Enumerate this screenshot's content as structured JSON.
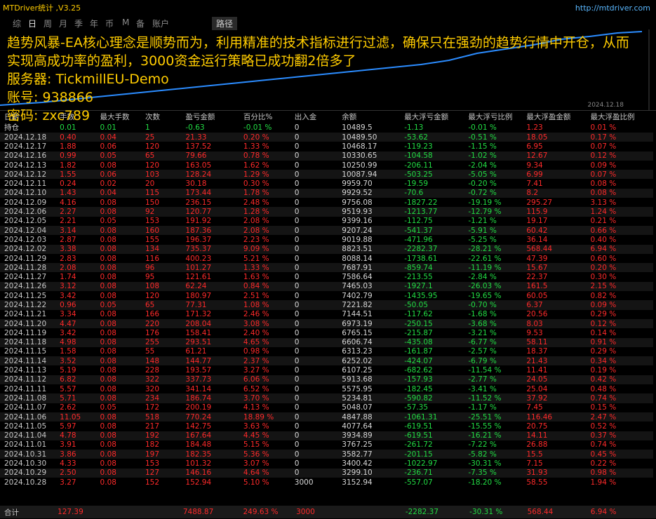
{
  "titlebar": {
    "app_title": "MTDriver统计 ,V3.25",
    "url": "http://mtdriver.com"
  },
  "tabs": [
    "综",
    "日",
    "周",
    "月",
    "季",
    "年",
    "币",
    "M",
    "备",
    "账户"
  ],
  "active_tab": "日",
  "path_tab": "路径",
  "overlay": {
    "line1": "趋势风暴-EA核心理念是顺势而为，利用精准的技术指标进行过滤，确保只在强劲的趋势行情中开仓，从而实现高成功率的盈利，3000资金运行策略已成功翻2倍多了",
    "server": "服务器: TickmillEU-Demo",
    "account": "账号: 938866",
    "password": "密码: zxc789"
  },
  "chart_date_label": "2024.12.18",
  "columns": [
    "日期",
    "手数",
    "最大手数",
    "次数",
    "盈亏金额",
    "百分比%",
    "出入金",
    "余额",
    "最大浮亏金额",
    "最大浮亏比例",
    "最大浮盈金额",
    "最大浮盈比例"
  ],
  "rows": [
    [
      "持仓",
      "0.01",
      "0.01",
      "1",
      "-0.63",
      "-0.01 %",
      "0",
      "10489.5",
      "-1.13",
      "-0.01 %",
      "1.23",
      "0.01 %"
    ],
    [
      "2024.12.18",
      "0.40",
      "0.04",
      "25",
      "21.33",
      "0.20 %",
      "0",
      "10489.50",
      "-53.62",
      "-0.51 %",
      "18.05",
      "0.17 %"
    ],
    [
      "2024.12.17",
      "1.88",
      "0.06",
      "120",
      "137.52",
      "1.33 %",
      "0",
      "10468.17",
      "-119.23",
      "-1.15 %",
      "6.95",
      "0.07 %"
    ],
    [
      "2024.12.16",
      "0.99",
      "0.05",
      "65",
      "79.66",
      "0.78 %",
      "0",
      "10330.65",
      "-104.58",
      "-1.02 %",
      "12.67",
      "0.12 %"
    ],
    [
      "2024.12.13",
      "1.82",
      "0.08",
      "120",
      "163.05",
      "1.62 %",
      "0",
      "10250.99",
      "-206.11",
      "-2.04 %",
      "9.34",
      "0.09 %"
    ],
    [
      "2024.12.12",
      "1.55",
      "0.06",
      "103",
      "128.24",
      "1.29 %",
      "0",
      "10087.94",
      "-503.25",
      "-5.05 %",
      "6.99",
      "0.07 %"
    ],
    [
      "2024.12.11",
      "0.24",
      "0.02",
      "20",
      "30.18",
      "0.30 %",
      "0",
      "9959.70",
      "-19.59",
      "-0.20 %",
      "7.41",
      "0.08 %"
    ],
    [
      "2024.12.10",
      "1.43",
      "0.04",
      "115",
      "173.44",
      "1.78 %",
      "0",
      "9929.52",
      "-70.6",
      "-0.72 %",
      "8.2",
      "0.08 %"
    ],
    [
      "2024.12.09",
      "4.16",
      "0.08",
      "150",
      "236.15",
      "2.48 %",
      "0",
      "9756.08",
      "-1827.22",
      "-19.19 %",
      "295.27",
      "3.13 %"
    ],
    [
      "2024.12.06",
      "2.27",
      "0.08",
      "92",
      "120.77",
      "1.28 %",
      "0",
      "9519.93",
      "-1213.77",
      "-12.79 %",
      "115.9",
      "1.24 %"
    ],
    [
      "2024.12.05",
      "2.21",
      "0.05",
      "153",
      "191.92",
      "2.08 %",
      "0",
      "9399.16",
      "-112.75",
      "-1.21 %",
      "19.17",
      "0.21 %"
    ],
    [
      "2024.12.04",
      "3.14",
      "0.08",
      "160",
      "187.36",
      "2.08 %",
      "0",
      "9207.24",
      "-541.37",
      "-5.91 %",
      "60.42",
      "0.66 %"
    ],
    [
      "2024.12.03",
      "2.87",
      "0.08",
      "155",
      "196.37",
      "2.23 %",
      "0",
      "9019.88",
      "-471.96",
      "-5.25 %",
      "36.14",
      "0.40 %"
    ],
    [
      "2024.12.02",
      "3.38",
      "0.08",
      "134",
      "735.37",
      "9.09 %",
      "0",
      "8823.51",
      "-2282.37",
      "-28.21 %",
      "568.44",
      "6.94 %"
    ],
    [
      "2024.11.29",
      "2.83",
      "0.08",
      "116",
      "400.23",
      "5.21 %",
      "0",
      "8088.14",
      "-1738.61",
      "-22.61 %",
      "47.39",
      "0.60 %"
    ],
    [
      "2024.11.28",
      "2.08",
      "0.08",
      "96",
      "101.27",
      "1.33 %",
      "0",
      "7687.91",
      "-859.74",
      "-11.19 %",
      "15.67",
      "0.20 %"
    ],
    [
      "2024.11.27",
      "1.74",
      "0.08",
      "95",
      "121.61",
      "1.63 %",
      "0",
      "7586.64",
      "-213.55",
      "-2.84 %",
      "22.37",
      "0.30 %"
    ],
    [
      "2024.11.26",
      "3.12",
      "0.08",
      "108",
      "62.24",
      "0.84 %",
      "0",
      "7465.03",
      "-1927.1",
      "-26.03 %",
      "161.5",
      "2.15 %"
    ],
    [
      "2024.11.25",
      "3.42",
      "0.08",
      "120",
      "180.97",
      "2.51 %",
      "0",
      "7402.79",
      "-1435.95",
      "-19.65 %",
      "60.05",
      "0.82 %"
    ],
    [
      "2024.11.22",
      "0.96",
      "0.05",
      "65",
      "77.31",
      "1.08 %",
      "0",
      "7221.82",
      "-50.05",
      "-0.70 %",
      "6.37",
      "0.09 %"
    ],
    [
      "2024.11.21",
      "3.34",
      "0.08",
      "166",
      "171.32",
      "2.46 %",
      "0",
      "7144.51",
      "-117.62",
      "-1.68 %",
      "20.56",
      "0.29 %"
    ],
    [
      "2024.11.20",
      "4.47",
      "0.08",
      "220",
      "208.04",
      "3.08 %",
      "0",
      "6973.19",
      "-250.15",
      "-3.68 %",
      "8.03",
      "0.12 %"
    ],
    [
      "2024.11.19",
      "3.42",
      "0.08",
      "176",
      "158.41",
      "2.40 %",
      "0",
      "6765.15",
      "-215.87",
      "-3.21 %",
      "9.53",
      "0.14 %"
    ],
    [
      "2024.11.18",
      "4.98",
      "0.08",
      "255",
      "293.51",
      "4.65 %",
      "0",
      "6606.74",
      "-435.08",
      "-6.77 %",
      "58.11",
      "0.91 %"
    ],
    [
      "2024.11.15",
      "1.58",
      "0.08",
      "55",
      "61.21",
      "0.98 %",
      "0",
      "6313.23",
      "-161.87",
      "-2.57 %",
      "18.37",
      "0.29 %"
    ],
    [
      "2024.11.14",
      "3.52",
      "0.08",
      "148",
      "144.77",
      "2.37 %",
      "0",
      "6252.02",
      "-424.07",
      "-6.79 %",
      "21.43",
      "0.34 %"
    ],
    [
      "2024.11.13",
      "5.19",
      "0.08",
      "228",
      "193.57",
      "3.27 %",
      "0",
      "6107.25",
      "-682.62",
      "-11.54 %",
      "11.41",
      "0.19 %"
    ],
    [
      "2024.11.12",
      "6.82",
      "0.08",
      "322",
      "337.73",
      "6.06 %",
      "0",
      "5913.68",
      "-157.93",
      "-2.77 %",
      "24.05",
      "0.42 %"
    ],
    [
      "2024.11.11",
      "5.57",
      "0.08",
      "320",
      "341.14",
      "6.52 %",
      "0",
      "5575.95",
      "-182.45",
      "-3.41 %",
      "25.04",
      "0.48 %"
    ],
    [
      "2024.11.08",
      "5.71",
      "0.08",
      "234",
      "186.74",
      "3.70 %",
      "0",
      "5234.81",
      "-590.82",
      "-11.52 %",
      "37.92",
      "0.74 %"
    ],
    [
      "2024.11.07",
      "2.62",
      "0.05",
      "172",
      "200.19",
      "4.13 %",
      "0",
      "5048.07",
      "-57.35",
      "-1.17 %",
      "7.45",
      "0.15 %"
    ],
    [
      "2024.11.06",
      "11.05",
      "0.08",
      "518",
      "770.24",
      "18.89 %",
      "0",
      "4847.88",
      "-1061.31",
      "-25.51 %",
      "116.46",
      "2.47 %"
    ],
    [
      "2024.11.05",
      "5.97",
      "0.08",
      "217",
      "142.75",
      "3.63 %",
      "0",
      "4077.64",
      "-619.51",
      "-15.55 %",
      "20.75",
      "0.52 %"
    ],
    [
      "2024.11.04",
      "4.78",
      "0.08",
      "192",
      "167.64",
      "4.45 %",
      "0",
      "3934.89",
      "-619.51",
      "-16.21 %",
      "14.11",
      "0.37 %"
    ],
    [
      "2024.11.01",
      "3.91",
      "0.08",
      "182",
      "184.48",
      "5.15 %",
      "0",
      "3767.25",
      "-261.72",
      "-7.22 %",
      "26.88",
      "0.74 %"
    ],
    [
      "2024.10.31",
      "3.86",
      "0.08",
      "197",
      "182.35",
      "5.36 %",
      "0",
      "3582.77",
      "-201.15",
      "-5.82 %",
      "15.5",
      "0.45 %"
    ],
    [
      "2024.10.30",
      "4.33",
      "0.08",
      "153",
      "101.32",
      "3.07 %",
      "0",
      "3400.42",
      "-1022.97",
      "-30.31 %",
      "7.15",
      "0.22 %"
    ],
    [
      "2024.10.29",
      "2.50",
      "0.08",
      "127",
      "146.16",
      "4.64 %",
      "0",
      "3299.10",
      "-236.71",
      "-7.35 %",
      "31.93",
      "0.98 %"
    ],
    [
      "2024.10.28",
      "3.27",
      "0.08",
      "152",
      "152.94",
      "5.10 %",
      "3000",
      "3152.94",
      "-557.07",
      "-18.20 %",
      "58.55",
      "1.94 %"
    ]
  ],
  "footer": [
    "合计",
    "127.39",
    "",
    "",
    "7488.87",
    "249.63 %",
    "3000",
    "",
    "-2282.37",
    "-30.31 %",
    "568.44",
    "6.94 %"
  ],
  "colors": {
    "yellow": "#ffcc00",
    "red": "#ff2a2a",
    "green": "#22dd44",
    "curve": "#2b8cff"
  }
}
